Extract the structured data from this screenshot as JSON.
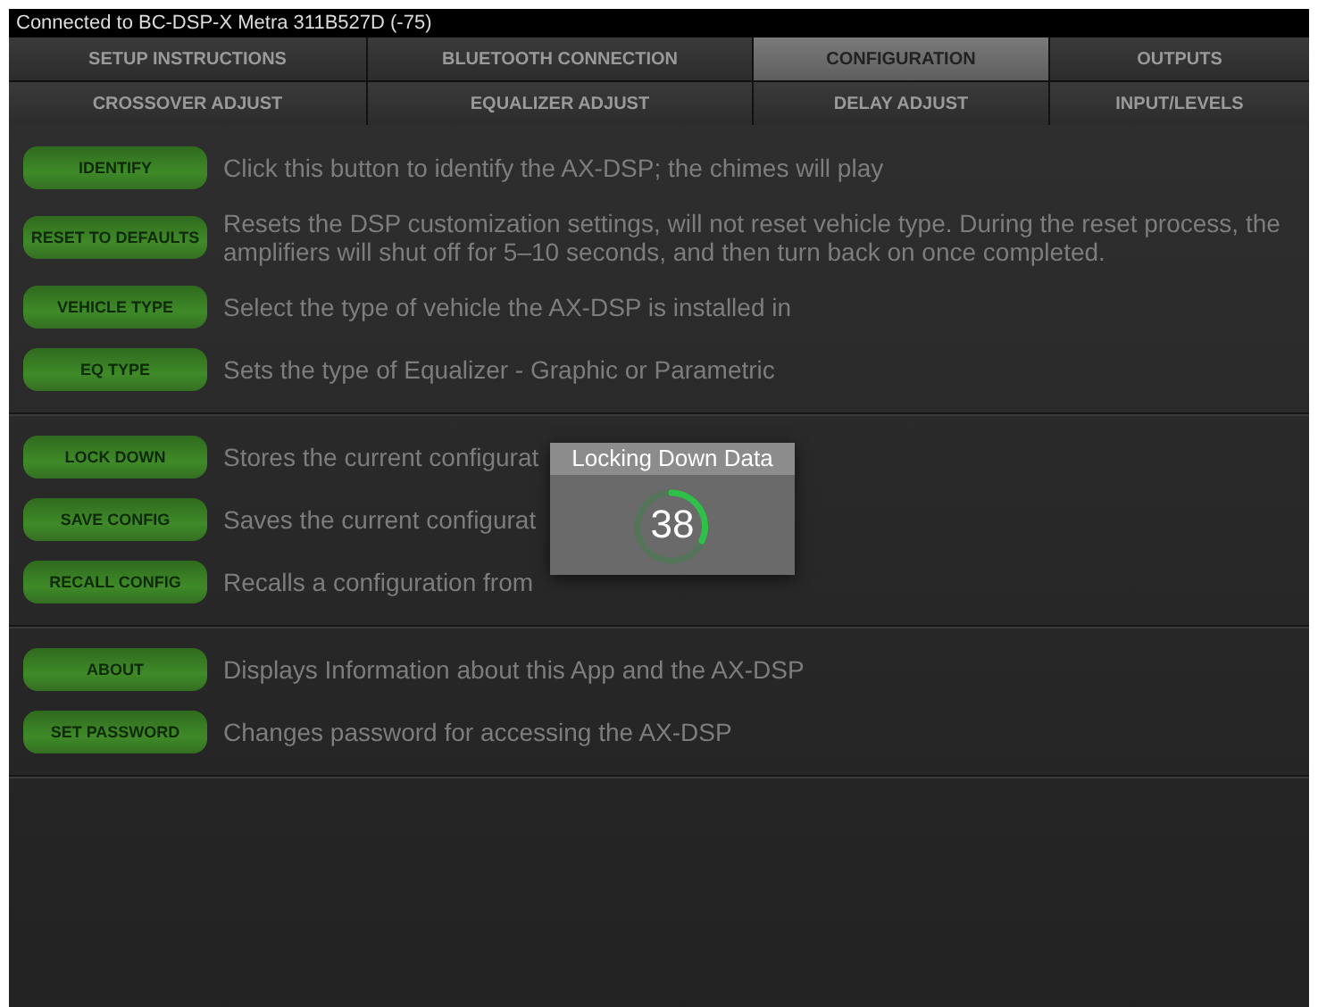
{
  "status_bar": {
    "text": "Connected to BC-DSP-X Metra 311B527D (-75)"
  },
  "tabs": [
    {
      "label": "SETUP INSTRUCTIONS",
      "selected": false
    },
    {
      "label": "BLUETOOTH CONNECTION",
      "selected": false
    },
    {
      "label": "CONFIGURATION",
      "selected": true
    },
    {
      "label": "OUTPUTS",
      "selected": false
    },
    {
      "label": "CROSSOVER ADJUST",
      "selected": false
    },
    {
      "label": "EQUALIZER ADJUST",
      "selected": false
    },
    {
      "label": "DELAY ADJUST",
      "selected": false
    },
    {
      "label": "INPUT/LEVELS",
      "selected": false
    }
  ],
  "sections": [
    {
      "rows": [
        {
          "button": "IDENTIFY",
          "description": "Click this button to identify the AX-DSP; the chimes will play"
        },
        {
          "button": "RESET TO DEFAULTS",
          "description": "Resets the DSP customization settings, will not reset vehicle type. During the reset process, the amplifiers will shut off for 5–10 seconds, and then turn back on once completed."
        },
        {
          "button": "VEHICLE TYPE",
          "description": "Select the type of vehicle the AX-DSP is installed in"
        },
        {
          "button": "EQ TYPE",
          "description": "Sets the type of Equalizer - Graphic or Parametric"
        }
      ]
    },
    {
      "rows": [
        {
          "button": "LOCK DOWN",
          "description": "Stores the current configurat"
        },
        {
          "button": "SAVE CONFIG",
          "description": "Saves the current configurat"
        },
        {
          "button": "RECALL CONFIG",
          "description": "Recalls a configuration from"
        }
      ]
    },
    {
      "rows": [
        {
          "button": "ABOUT",
          "description": "Displays Information about this App and the AX-DSP"
        },
        {
          "button": "SET PASSWORD",
          "description": "Changes password for accessing the AX-DSP"
        }
      ]
    }
  ],
  "dialog": {
    "title": "Locking Down Data",
    "count": "38"
  }
}
